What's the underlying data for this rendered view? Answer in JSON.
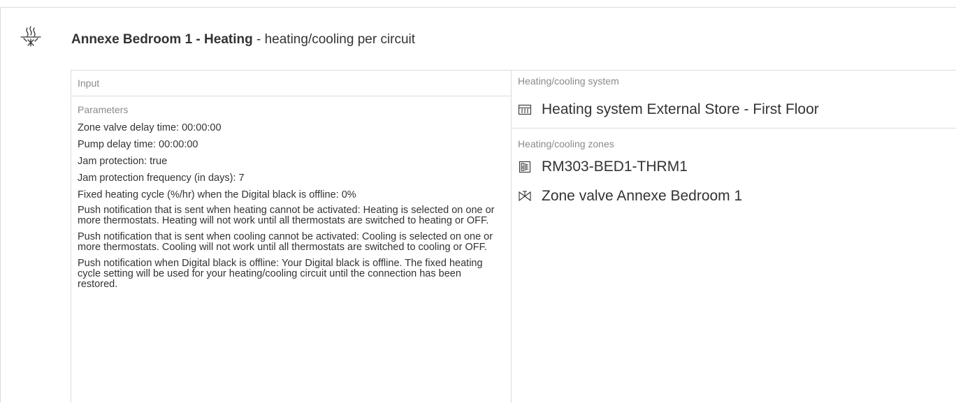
{
  "header": {
    "title": "Annexe Bedroom 1 - Heating",
    "subtitle": " - heating/cooling per circuit"
  },
  "input": {
    "section_label": "Input",
    "parameters_label": "Parameters",
    "parameters": [
      "Zone valve delay time: 00:00:00",
      "Pump delay time: 00:00:00",
      "Jam protection: true",
      "Jam protection frequency (in days): 7",
      "Fixed heating cycle (%/hr) when the Digital black is offline: 0%",
      "Push notification that is sent when heating cannot be activated: Heating is selected on one or more thermostats. Heating will not work until all thermostats are switched to heating or OFF.",
      "Push notification that is sent when cooling cannot be activated: Cooling is selected on one or more thermostats. Cooling will not work until all thermostats are switched to cooling or OFF.",
      "Push notification when Digital black is offline: Your Digital black is offline. The fixed heating cycle setting will be used for your heating/cooling circuit until the connection has been restored."
    ]
  },
  "system": {
    "section_label": "Heating/cooling system",
    "name": "Heating system External Store - First Floor",
    "icon": "radiator-icon"
  },
  "zones": {
    "section_label": "Heating/cooling zones",
    "items": [
      {
        "name": "RM303-BED1-THRM1",
        "icon": "thermostat-icon"
      },
      {
        "name": "Zone valve Annexe Bedroom 1",
        "icon": "valve-icon"
      }
    ]
  },
  "colors": {
    "border": "#dcdcdc",
    "label": "#8a8a8a",
    "text": "#333333"
  }
}
